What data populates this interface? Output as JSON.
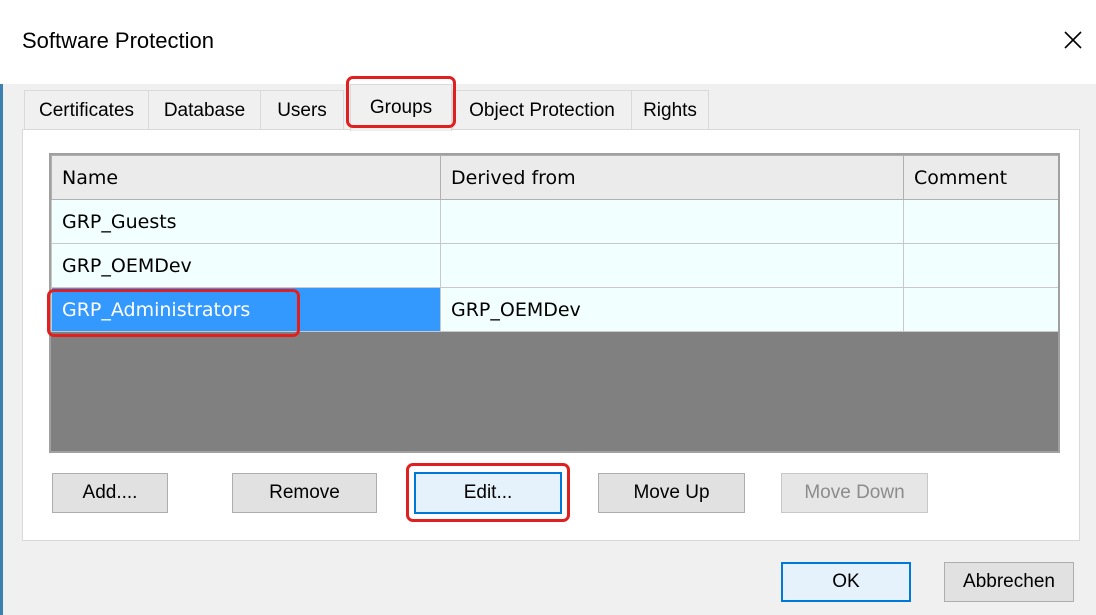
{
  "window": {
    "title": "Software Protection",
    "close_icon": "close-icon"
  },
  "tabs": [
    {
      "label": "Certificates",
      "active": false
    },
    {
      "label": "Database",
      "active": false
    },
    {
      "label": "Users",
      "active": false
    },
    {
      "label": "Groups",
      "active": true
    },
    {
      "label": "Object Protection",
      "active": false
    },
    {
      "label": "Rights",
      "active": false
    }
  ],
  "table": {
    "columns": [
      "Name",
      "Derived from",
      "Comment"
    ],
    "rows": [
      {
        "name": "GRP_Guests",
        "derived_from": "",
        "comment": ""
      },
      {
        "name": "GRP_OEMDev",
        "derived_from": "",
        "comment": ""
      },
      {
        "name": "GRP_Administrators",
        "derived_from": "GRP_OEMDev",
        "comment": "",
        "selected": true
      }
    ]
  },
  "buttons": {
    "add": "Add....",
    "remove": "Remove",
    "edit": "Edit...",
    "move_up": "Move Up",
    "move_down": "Move Down"
  },
  "footer": {
    "ok": "OK",
    "cancel": "Abbrechen"
  },
  "colors": {
    "highlight": "#e02020",
    "selection": "#3399ff",
    "accent": "#0078d7"
  }
}
